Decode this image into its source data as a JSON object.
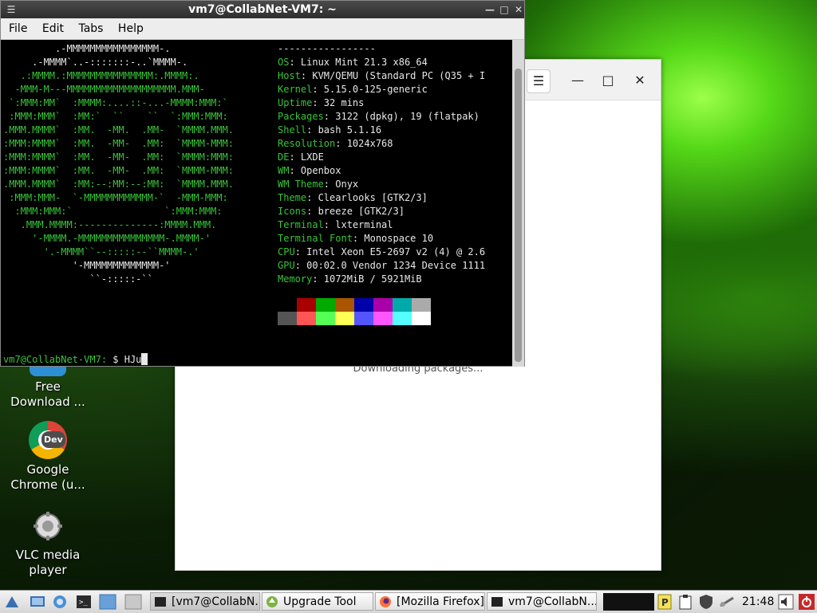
{
  "terminal": {
    "title": "vm7@CollabNet-VM7: ~",
    "menu": [
      "File",
      "Edit",
      "Tabs",
      "Help"
    ],
    "logo_lines": [
      "         .-MMMMMMMMMMMMMMMM-.",
      "     .-MMMM`..-:::::::-..`MMMM-.",
      "   .:MMMM.:MMMMMMMMMMMMMMM:.MMMM:.",
      "  -MMM-M---MMMMMMMMMMMMMMMMMMM.MMM-",
      " `:MMM:MM`  :MMMM:....::-...-MMMM:MMM:`",
      " :MMM:MMM`  :MM:`  ``    ``  `:MMM:MMM:",
      ".MMM.MMMM`  :MM.  -MM.  .MM-  `MMMM.MMM.",
      ":MMM:MMMM`  :MM.  -MM-  .MM:  `MMMM-MMM:",
      ":MMM:MMMM`  :MM.  -MM-  .MM:  `MMMM:MMM:",
      ":MMM:MMMM`  :MM.  -MM-  .MM:  `MMMM-MMM:",
      ".MMM.MMMM`  :MM:--:MM:--:MM:  `MMMM.MMM.",
      " :MMM:MMM-  `-MMMMMMMMMMMM-`  -MMM-MMM:",
      "  :MMM:MMM:`                `:MMM:MMM:",
      "   .MMM.MMMM:--------------:MMMM.MMM.",
      "     '-MMMM.-MMMMMMMMMMMMMMM-.MMMM-'",
      "       '.-MMMM``--:::::--``MMMM-.'",
      "            '-MMMMMMMMMMMMM-'",
      "               ``-:::::-``"
    ],
    "separator": "-----------------",
    "info": [
      {
        "key": "OS",
        "value": "Linux Mint 21.3 x86_64"
      },
      {
        "key": "Host",
        "value": "KVM/QEMU (Standard PC (Q35 + I"
      },
      {
        "key": "Kernel",
        "value": "5.15.0-125-generic"
      },
      {
        "key": "Uptime",
        "value": "32 mins"
      },
      {
        "key": "Packages",
        "value": "3122 (dpkg), 19 (flatpak)"
      },
      {
        "key": "Shell",
        "value": "bash 5.1.16"
      },
      {
        "key": "Resolution",
        "value": "1024x768"
      },
      {
        "key": "DE",
        "value": "LXDE"
      },
      {
        "key": "WM",
        "value": "Openbox"
      },
      {
        "key": "WM Theme",
        "value": "Onyx"
      },
      {
        "key": "Theme",
        "value": "Clearlooks [GTK2/3]"
      },
      {
        "key": "Icons",
        "value": "breeze [GTK2/3]"
      },
      {
        "key": "Terminal",
        "value": "lxterminal"
      },
      {
        "key": "Terminal Font",
        "value": "Monospace 10"
      },
      {
        "key": "CPU",
        "value": "Intel Xeon E5-2697 v2 (4) @ 2.6"
      },
      {
        "key": "GPU",
        "value": "00:02.0 Vendor 1234 Device 1111"
      },
      {
        "key": "Memory",
        "value": "1072MiB / 5921MiB"
      }
    ],
    "palette_row1": [
      "#000000",
      "#aa0000",
      "#00aa00",
      "#aa5500",
      "#0000aa",
      "#aa00aa",
      "#00aaaa",
      "#aaaaaa"
    ],
    "palette_row2": [
      "#555555",
      "#ff5555",
      "#55ff55",
      "#ffff55",
      "#5555ff",
      "#ff55ff",
      "#55ffff",
      "#ffffff"
    ],
    "prompt": "vm7@CollabNet-VM7:",
    "prompt_suffix": " $ ",
    "command_input": "HJu"
  },
  "upgrade_window": {
    "status": "Downloading packages..."
  },
  "desktop_icons": [
    {
      "label": "Free Download ...",
      "icon": "download-icon"
    },
    {
      "label": "Google Chrome (u...",
      "icon": "chrome-dev-icon"
    },
    {
      "label": "VLC media player",
      "icon": "vlc-icon"
    }
  ],
  "taskbar": {
    "tasks": [
      {
        "label": "[vm7@CollabN...",
        "icon": "terminal-icon"
      },
      {
        "label": "Upgrade Tool",
        "icon": "upgrade-icon"
      },
      {
        "label": "[Mozilla Firefox]",
        "icon": "firefox-icon"
      },
      {
        "label": "vm7@CollabN...",
        "icon": "terminal-icon"
      }
    ],
    "clock": "21:48"
  },
  "colors": {
    "terminal_green": "#39c43a",
    "terminal_text": "#e8e8e8"
  }
}
